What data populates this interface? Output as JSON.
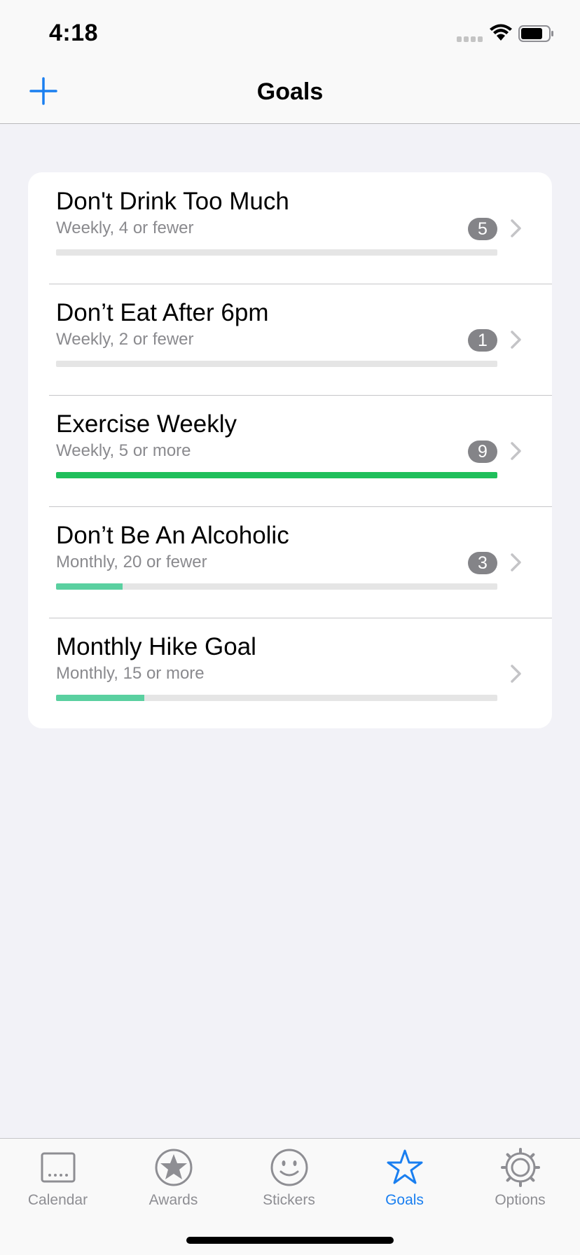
{
  "status_bar": {
    "time": "4:18"
  },
  "nav": {
    "title": "Goals"
  },
  "colors": {
    "accent": "#1a7ff0",
    "badge": "#848488",
    "complete": "#1fbf5b",
    "partial": "#5ad0a0"
  },
  "goals": [
    {
      "title": "Don't Drink Too Much",
      "subtitle": "Weekly, 4 or fewer",
      "badge": "5",
      "progress": 0,
      "fill_color": "#5ad0a0"
    },
    {
      "title": "Don’t Eat After 6pm",
      "subtitle": "Weekly, 2 or fewer",
      "badge": "1",
      "progress": 0,
      "fill_color": "#5ad0a0"
    },
    {
      "title": "Exercise Weekly",
      "subtitle": "Weekly, 5 or more",
      "badge": "9",
      "progress": 1.0,
      "fill_color": "#1fbf5b"
    },
    {
      "title": "Don’t Be An Alcoholic",
      "subtitle": "Monthly, 20 or fewer",
      "badge": "3",
      "progress": 0.15,
      "fill_color": "#5ad0a0"
    },
    {
      "title": "Monthly Hike Goal",
      "subtitle": "Monthly, 15 or more",
      "badge": "",
      "progress": 0.2,
      "fill_color": "#5ad0a0"
    }
  ],
  "tabs": [
    {
      "label": "Calendar",
      "icon": "calendar-icon",
      "active": false
    },
    {
      "label": "Awards",
      "icon": "award-star-icon",
      "active": false
    },
    {
      "label": "Stickers",
      "icon": "smiley-icon",
      "active": false
    },
    {
      "label": "Goals",
      "icon": "star-outline-icon",
      "active": true
    },
    {
      "label": "Options",
      "icon": "gear-icon",
      "active": false
    }
  ]
}
